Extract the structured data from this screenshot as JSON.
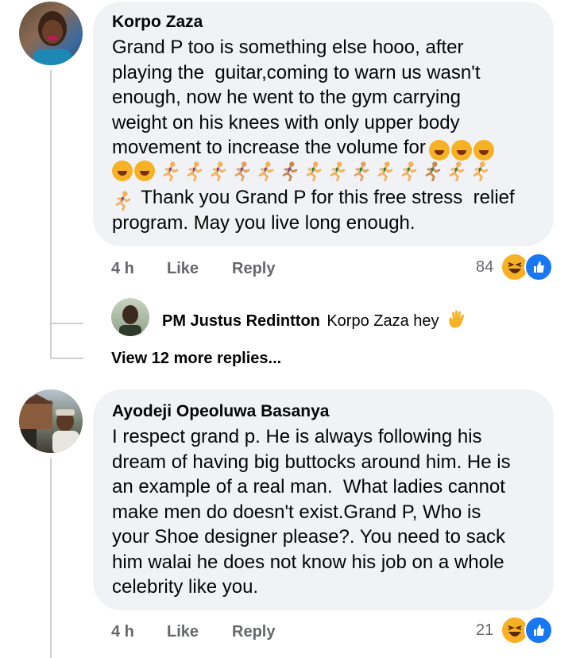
{
  "comments": [
    {
      "author": "Korpo Zaza",
      "lines": [
        "Grand P too is something else hooo, after",
        "playing the  guitar,coming to warn us wasn't",
        "enough, now he went to the gym carrying",
        "weight on his knees with only upper body",
        "movement to increase the volume for",
        " Thank you Grand P for this free stress  relief",
        "program. May you live long enough."
      ],
      "time": "4 h",
      "like_label": "Like",
      "reply_label": "Reply",
      "reaction_count": "84",
      "reaction_icons": [
        "haha-icon",
        "like-icon"
      ]
    },
    {
      "author": "Ayodeji Opeoluwa Basanya",
      "text": "I respect grand p. He is always following his\ndream of having big buttocks around him. He is\nan example of a real man.  What ladies cannot\nmake men do doesn't exist.Grand P, Who is\nyour Shoe designer please?. You need to sack\nhim walai he does not know his job on a whole\ncelebrity like you.",
      "time": "4 h",
      "like_label": "Like",
      "reply_label": "Reply",
      "reaction_count": "21",
      "reaction_icons": [
        "haha-icon",
        "like-icon"
      ]
    }
  ],
  "reply_preview": {
    "author": "PM Justus Redintton",
    "text": "Korpo Zaza  hey",
    "emoji": "waving-hand-icon"
  },
  "view_more": "View 12 more replies...",
  "colors": {
    "bubble": "#f0f2f5",
    "meta": "#65676b",
    "like_blue": "#1877f2",
    "haha_yellow": "#f7b125"
  }
}
